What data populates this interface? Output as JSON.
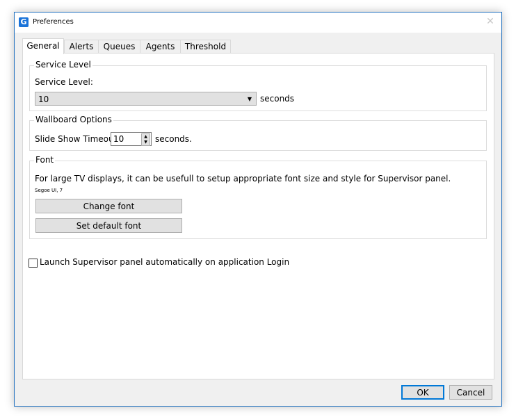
{
  "window": {
    "title": "Preferences",
    "app_icon": "G"
  },
  "tabs": [
    {
      "label": "General",
      "active": true
    },
    {
      "label": "Alerts",
      "active": false
    },
    {
      "label": "Queues",
      "active": false
    },
    {
      "label": "Agents",
      "active": false
    },
    {
      "label": "Threshold",
      "active": false
    }
  ],
  "service_level": {
    "group_title": "Service Level",
    "label": "Service Level:",
    "value": "10",
    "unit": "seconds"
  },
  "wallboard": {
    "group_title": "Wallboard Options",
    "label": "Slide Show Timeout:",
    "value": "10",
    "unit": "seconds."
  },
  "font": {
    "group_title": "Font",
    "description": "For large TV displays, it can be usefull to setup appropriate font size and style for Supervisor panel.",
    "current_font": "Segoe UI, 7",
    "change_button": "Change font",
    "default_button": "Set default font"
  },
  "launch_checkbox": {
    "label": "Launch Supervisor panel automatically on application Login",
    "checked": false
  },
  "footer": {
    "ok": "OK",
    "cancel": "Cancel"
  },
  "icons": {
    "close": "close-icon",
    "dropdown": "chevron-down-icon",
    "spin_up": "spin-up-icon",
    "spin_down": "spin-down-icon"
  },
  "colors": {
    "window_border": "#1f6fbf",
    "button_focus": "#0078d7",
    "button_bg": "#e1e1e1"
  }
}
